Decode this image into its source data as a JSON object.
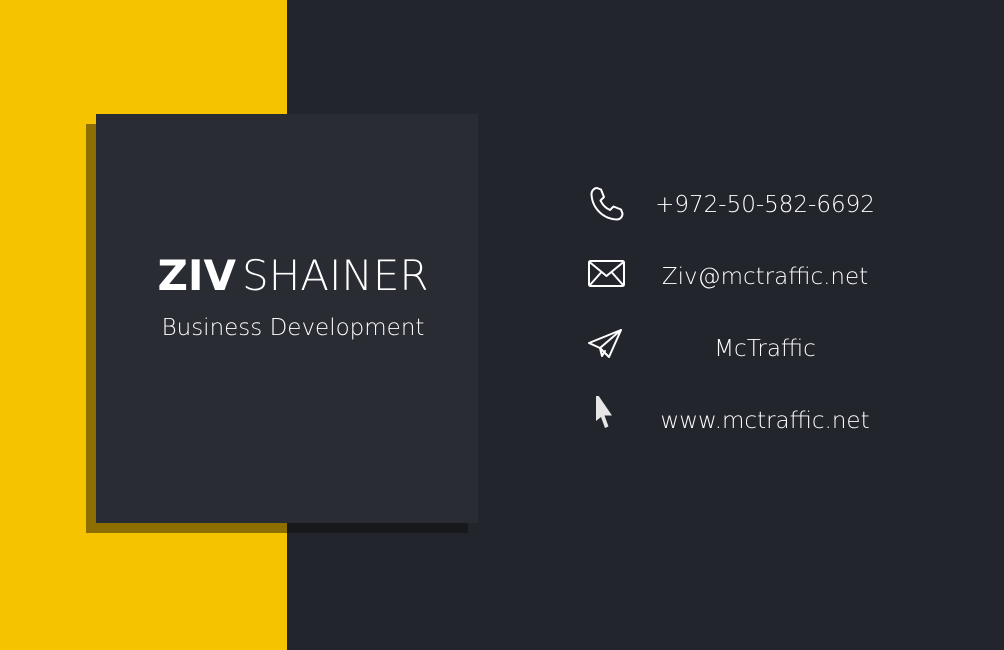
{
  "card": {
    "first_name": "ZIV",
    "last_name": "SHAINER",
    "role": "Business Development"
  },
  "contacts": {
    "phone": {
      "icon": "phone-icon",
      "text": "+972-50-582-6692"
    },
    "email": {
      "icon": "envelope-icon",
      "text": "Ziv@mctraffic.net"
    },
    "telegram": {
      "icon": "paper-plane-icon",
      "text": "McTraffic"
    },
    "website": {
      "icon": "cursor-icon",
      "text": "www.mctraffic.net"
    }
  },
  "colors": {
    "accent_yellow": "#f6c300",
    "background_dark": "#23252c",
    "card_dark": "#2a2c33",
    "text": "#ffffff"
  }
}
